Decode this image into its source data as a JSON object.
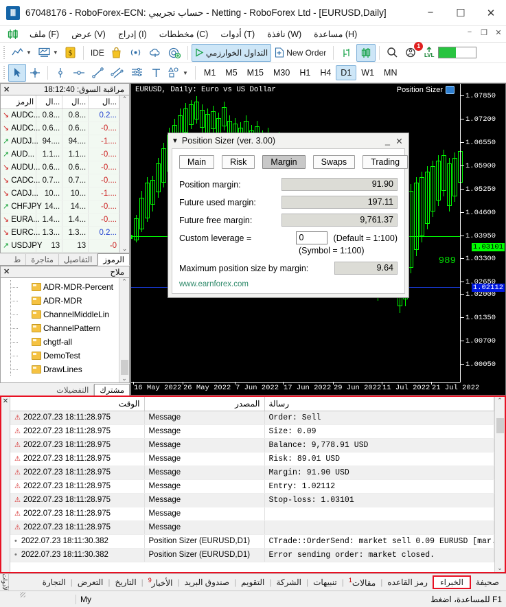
{
  "window": {
    "title": "67048176 - RoboForex-ECN: حساب تجريبي - Netting - RoboForex Ltd - [EURUSD,Daily]",
    "logo": "metatrader-logo",
    "minimize": "−",
    "maximize": "☐",
    "close": "✕"
  },
  "menu": {
    "items": [
      {
        "label": "ملف (F)",
        "name": "menu-file"
      },
      {
        "label": "عرض (V)",
        "name": "menu-view"
      },
      {
        "label": "إدراج (I)",
        "name": "menu-insert"
      },
      {
        "label": "مخططات (C)",
        "name": "menu-charts"
      },
      {
        "label": "أدوات (T)",
        "name": "menu-tools"
      },
      {
        "label": "نافذة (W)",
        "name": "menu-window"
      },
      {
        "label": "مساعدة (H)",
        "name": "menu-help"
      }
    ],
    "mdi": {
      "minimize": "−",
      "restore": "❐",
      "close": "✕"
    }
  },
  "toolbar": {
    "ide_label": "IDE",
    "algo_trading_label": "التداول الخوارزمي",
    "new_order_label": "New Order",
    "lvl_label": "LVL",
    "notification_count": "1"
  },
  "timeframes": {
    "items": [
      "M1",
      "M5",
      "M15",
      "M30",
      "H1",
      "H4",
      "D1",
      "W1",
      "MN"
    ],
    "selected": "D1"
  },
  "market_watch": {
    "title": "مراقبة السوق: 18:12:40",
    "close": "✕",
    "columns": [
      "الرمز",
      "ال...",
      "ال...",
      "ال..."
    ],
    "rows": [
      {
        "dir": "down",
        "symbol": "AUDC...",
        "bid": "0.8...",
        "ask": "0.8...",
        "chg": "0.2...",
        "chg_sign": "pos"
      },
      {
        "dir": "down",
        "symbol": "AUDC...",
        "bid": "0.6...",
        "ask": "0.6...",
        "chg": "-0....",
        "chg_sign": "neg"
      },
      {
        "dir": "up",
        "symbol": "AUDJ...",
        "bid": "94....",
        "ask": "94....",
        "chg": "-1....",
        "chg_sign": "neg"
      },
      {
        "dir": "up",
        "symbol": "AUD...",
        "bid": "1.1...",
        "ask": "1.1...",
        "chg": "-0....",
        "chg_sign": "neg"
      },
      {
        "dir": "down",
        "symbol": "AUDU...",
        "bid": "0.6...",
        "ask": "0.6...",
        "chg": "-0....",
        "chg_sign": "neg"
      },
      {
        "dir": "down",
        "symbol": "CADC...",
        "bid": "0.7...",
        "ask": "0.7...",
        "chg": "-0....",
        "chg_sign": "neg"
      },
      {
        "dir": "down",
        "symbol": "CADJ...",
        "bid": "10...",
        "ask": "10...",
        "chg": "-1....",
        "chg_sign": "neg"
      },
      {
        "dir": "up",
        "symbol": "CHFJPY",
        "bid": "14...",
        "ask": "14...",
        "chg": "-0....",
        "chg_sign": "neg"
      },
      {
        "dir": "down",
        "symbol": "EURA...",
        "bid": "1.4...",
        "ask": "1.4...",
        "chg": "-0....",
        "chg_sign": "neg"
      },
      {
        "dir": "down",
        "symbol": "EURC...",
        "bid": "1.3...",
        "ask": "1.3...",
        "chg": "0.2...",
        "chg_sign": "pos"
      },
      {
        "dir": "up",
        "symbol": "USDJPY",
        "bid": "13",
        "ask": "13",
        "chg": "-0",
        "chg_sign": "neg"
      }
    ],
    "tabs": [
      {
        "label": "الرموز",
        "selected": true
      },
      {
        "label": "التفاصيل",
        "selected": false
      },
      {
        "label": "متاجرة",
        "selected": false
      },
      {
        "label": "ط",
        "selected": false
      }
    ]
  },
  "navigator": {
    "title": "ملاح",
    "close": "✕",
    "items": [
      "ADR-MDR-Percent",
      "ADR-MDR",
      "ChannelMiddleLin",
      "ChannelPattern",
      "chgtf-all",
      "DemoTest",
      "DrawLines"
    ],
    "tabs": [
      {
        "label": "مشترك",
        "selected": true
      },
      {
        "label": "التفضيلات",
        "selected": false
      }
    ]
  },
  "chart": {
    "title": "EURUSD, Daily:  Euro vs US Dollar",
    "indicator_label": "Position Sizer",
    "price_ticks": [
      "1.07850",
      "1.07200",
      "1.06550",
      "1.05900",
      "1.05250",
      "1.04600",
      "1.03950",
      "1.03300",
      "1.02650",
      "1.02000",
      "1.01350",
      "1.00700",
      "1.00050"
    ],
    "bid_label": "1.03101",
    "entry_label": "1.02112",
    "level_text": "989",
    "date_ticks": [
      "16 May 2022",
      "26 May 2022",
      "7 Jun 2022",
      "17 Jun 2022",
      "29 Jun 2022",
      "11 Jul 2022",
      "21 Jul 2022"
    ],
    "colors": {
      "stoploss_line": "#00ff00",
      "entry_line": "#0018e0",
      "candle": "#00ff00",
      "background": "#000000"
    }
  },
  "position_sizer": {
    "title": "Position Sizer (ver. 3.00)",
    "collapse": "▼",
    "minimize": "_",
    "close": "✕",
    "tabs": [
      {
        "label": "Main",
        "selected": false
      },
      {
        "label": "Risk",
        "selected": false
      },
      {
        "label": "Margin",
        "selected": true
      },
      {
        "label": "Swaps",
        "selected": false
      },
      {
        "label": "Trading",
        "selected": false
      }
    ],
    "fields": [
      {
        "label": "Position margin:",
        "value": "91.90"
      },
      {
        "label": "Future used margin:",
        "value": "197.11"
      },
      {
        "label": "Future free margin:",
        "value": "9,761.37"
      }
    ],
    "leverage_label": "Custom leverage =",
    "leverage_value": "0",
    "leverage_default": "(Default = 1:100)",
    "leverage_symbol": "(Symbol = 1:100)",
    "max_size_label": "Maximum position size by margin:",
    "max_size_value": "9.64",
    "link": "www.earnforex.com"
  },
  "experts_log": {
    "close": "✕",
    "columns": {
      "time": "الوقت",
      "source": "المصدر",
      "message": "رسالة"
    },
    "rows": [
      {
        "icon": "warning",
        "time": "2022.07.23 18:11:28.975",
        "source": "Message",
        "message": "Order: Sell"
      },
      {
        "icon": "warning",
        "time": "2022.07.23 18:11:28.975",
        "source": "Message",
        "message": "Size: 0.09"
      },
      {
        "icon": "warning",
        "time": "2022.07.23 18:11:28.975",
        "source": "Message",
        "message": "Balance: 9,778.91 USD"
      },
      {
        "icon": "warning",
        "time": "2022.07.23 18:11:28.975",
        "source": "Message",
        "message": "Risk: 89.01 USD"
      },
      {
        "icon": "warning",
        "time": "2022.07.23 18:11:28.975",
        "source": "Message",
        "message": "Margin: 91.90 USD"
      },
      {
        "icon": "warning",
        "time": "2022.07.23 18:11:28.975",
        "source": "Message",
        "message": "Entry: 1.02112"
      },
      {
        "icon": "warning",
        "time": "2022.07.23 18:11:28.975",
        "source": "Message",
        "message": "Stop-loss: 1.03101"
      },
      {
        "icon": "warning",
        "time": "2022.07.23 18:11:28.975",
        "source": "Message",
        "message": ""
      },
      {
        "icon": "warning",
        "time": "2022.07.23 18:11:28.975",
        "source": "Message",
        "message": ""
      },
      {
        "icon": "dot",
        "time": "2022.07.23 18:11:30.382",
        "source": "Position Sizer (EURUSD,D1)",
        "message": "CTrade::OrderSend: market sell 0.09 EURUSD [mar..."
      },
      {
        "icon": "dot",
        "time": "2022.07.23 18:11:30.382",
        "source": "Position Sizer (EURUSD,D1)",
        "message": "Error sending order: market closed."
      }
    ],
    "side_label": "الأدوات"
  },
  "bottom_tabs": {
    "items": [
      {
        "label": "صحيفة",
        "selected": false
      },
      {
        "label": "الخبراء",
        "selected": true
      },
      {
        "label": "رمز القاعده",
        "selected": false
      },
      {
        "label": "مقالات",
        "selected": false,
        "sup": "1"
      },
      {
        "label": "تنبيهات",
        "selected": false
      },
      {
        "label": "الشركة",
        "selected": false
      },
      {
        "label": "التقويم",
        "selected": false
      },
      {
        "label": "صندوق البريد",
        "selected": false
      },
      {
        "label": "الأخبار",
        "selected": false,
        "sup": "9"
      },
      {
        "label": "التاريخ",
        "selected": false
      },
      {
        "label": "التعرض",
        "selected": false
      },
      {
        "label": "التجارة",
        "selected": false
      }
    ],
    "side_label": "الأدوات"
  },
  "status_bar": {
    "help": "للمساعدة، اضغط F1",
    "profile": "My"
  }
}
